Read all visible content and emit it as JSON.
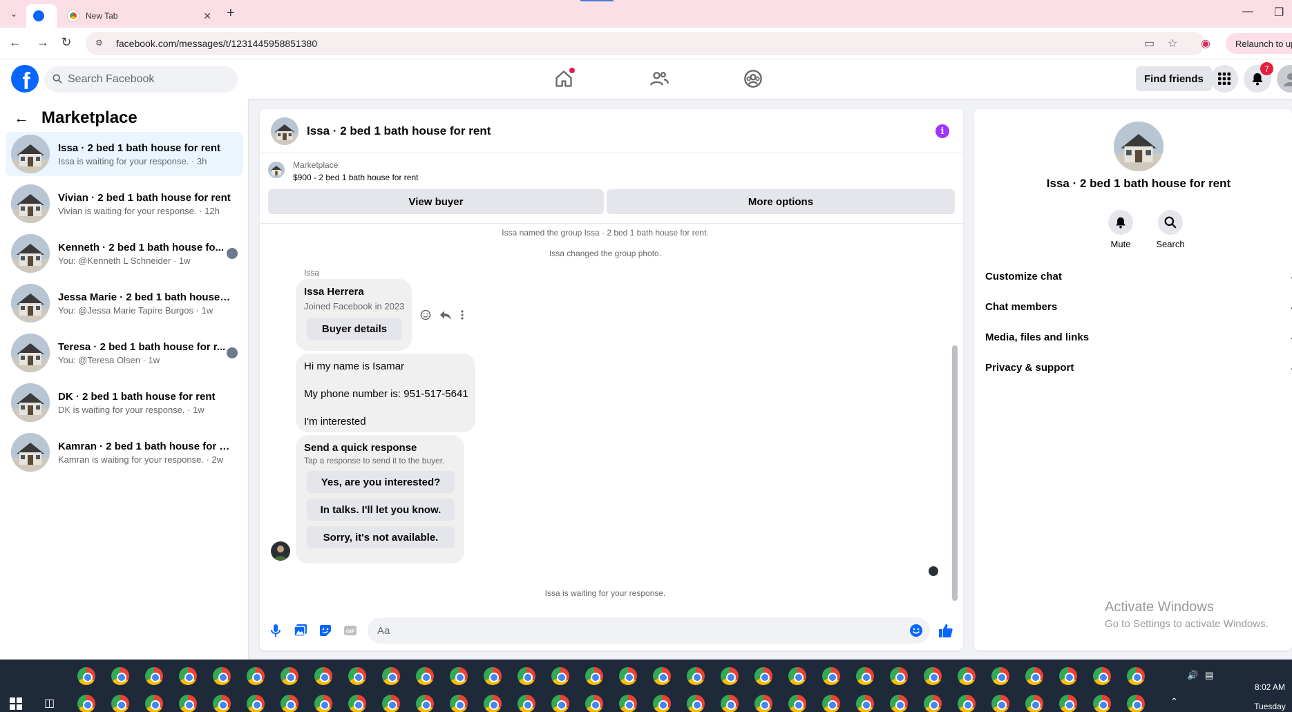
{
  "browser": {
    "tabs": [
      {
        "label": "",
        "active": true
      },
      {
        "label": "New Tab",
        "active": false
      }
    ],
    "url": "facebook.com/messages/t/1231445958851380",
    "relaunch_label": "Relaunch to upda"
  },
  "header": {
    "logo": "f",
    "search_placeholder": "Search Facebook",
    "find_friends": "Find friends",
    "notification_count": "7"
  },
  "sidebar": {
    "title": "Marketplace",
    "conversations": [
      {
        "name": "Issa · 2 bed 1 bath house for rent",
        "sub": "Issa is waiting for your response. · 3h",
        "active": true
      },
      {
        "name": "Vivian · 2 bed 1 bath house for rent",
        "sub": "Vivian is waiting for your response. · 12h"
      },
      {
        "name": "Kenneth · 2 bed 1 bath house fo...",
        "sub": "You: @Kenneth L Schneider · 1w"
      },
      {
        "name": "Jessa Marie · 2 bed 1 bath house f...",
        "sub": "You: @Jessa Marie Tapire Burgos · 1w"
      },
      {
        "name": "Teresa · 2 bed 1 bath house for r...",
        "sub": "You: @Teresa Olsen · 1w"
      },
      {
        "name": "DK · 2 bed 1 bath house for rent",
        "sub": "DK is waiting for your response. · 1w"
      },
      {
        "name": "Kamran · 2 bed 1 bath house for re...",
        "sub": "Kamran is waiting for your response. · 2w"
      }
    ]
  },
  "chat": {
    "title": "Issa · 2 bed 1 bath house for rent",
    "info_icon": "i",
    "marketplace_label": "Marketplace",
    "listing": "$900 - 2 bed 1 bath house for rent",
    "view_buyer": "View buyer",
    "more_options": "More options",
    "system_messages": [
      "Issa named the group Issa · 2 bed 1 bath house for rent.",
      "Issa changed the group photo."
    ],
    "sender_name": "Issa",
    "profile_card": {
      "name": "Issa Herrera",
      "joined": "Joined Facebook in 2023",
      "button": "Buyer details"
    },
    "message_lines": [
      "Hi my name is Isamar",
      "My phone number is: 951-517-5641",
      "I'm interested"
    ],
    "quick_response": {
      "title": "Send a quick response",
      "subtitle": "Tap a response to send it to the buyer.",
      "options": [
        "Yes, are you interested?",
        "In talks. I'll let you know.",
        "Sorry, it's not available."
      ]
    },
    "waiting_status": "Issa is waiting for your response.",
    "composer_placeholder": "Aa"
  },
  "details": {
    "title": "Issa · 2 bed 1 bath house for rent",
    "actions": [
      {
        "label": "Mute",
        "icon": "bell-icon"
      },
      {
        "label": "Search",
        "icon": "search-icon"
      }
    ],
    "sections": [
      "Customize chat",
      "Chat members",
      "Media, files and links",
      "Privacy & support"
    ]
  },
  "watermark": {
    "line1": "Activate Windows",
    "line2": "Go to Settings to activate Windows."
  },
  "taskbar": {
    "time": "8:02 AM",
    "day": "Tuesday"
  },
  "colors": {
    "brand": "#0866ff",
    "accent_purple": "#a033ff",
    "active_row": "#ebf5ff",
    "taskbar": "#1e2a3a"
  }
}
